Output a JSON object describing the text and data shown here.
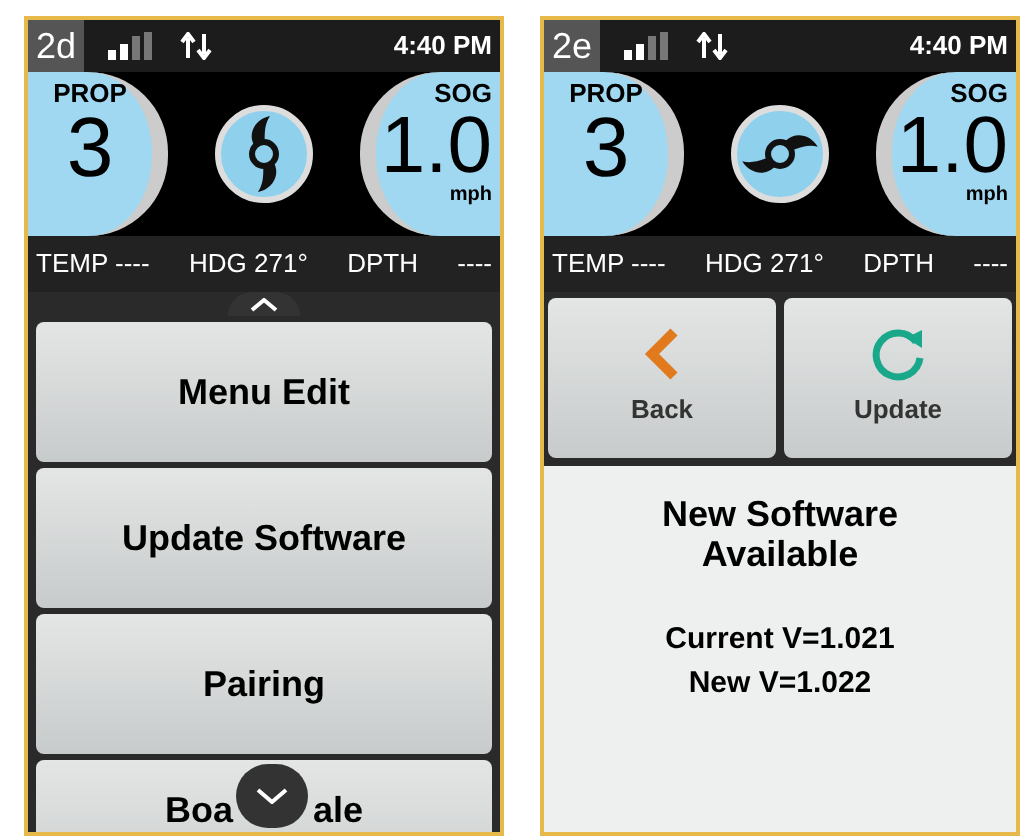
{
  "screens": [
    {
      "kind": "menu",
      "id": "2d",
      "time": "4:40 PM",
      "prop_label": "PROP",
      "prop_value": "3",
      "sog_label": "SOG",
      "sog_value": "1.0",
      "sog_unit": "mph",
      "info": [
        "TEMP ----",
        "HDG 271°",
        "DPTH",
        "----"
      ],
      "menu": [
        {
          "label": "Menu Edit"
        },
        {
          "label": "Update Software"
        },
        {
          "label": "Pairing"
        }
      ],
      "partial_item": [
        "Boa",
        "ale"
      ]
    },
    {
      "kind": "update",
      "id": "2e",
      "time": "4:40 PM",
      "prop_label": "PROP",
      "prop_value": "3",
      "sog_label": "SOG",
      "sog_value": "1.0",
      "sog_unit": "mph",
      "info": [
        "TEMP ----",
        "HDG 271°",
        "DPTH",
        "----"
      ],
      "buttons": [
        {
          "kind": "back",
          "label": "Back"
        },
        {
          "kind": "update",
          "label": "Update"
        }
      ],
      "title": "New Software Available",
      "lines": [
        "Current V=1.021",
        "New V=1.022"
      ]
    }
  ]
}
